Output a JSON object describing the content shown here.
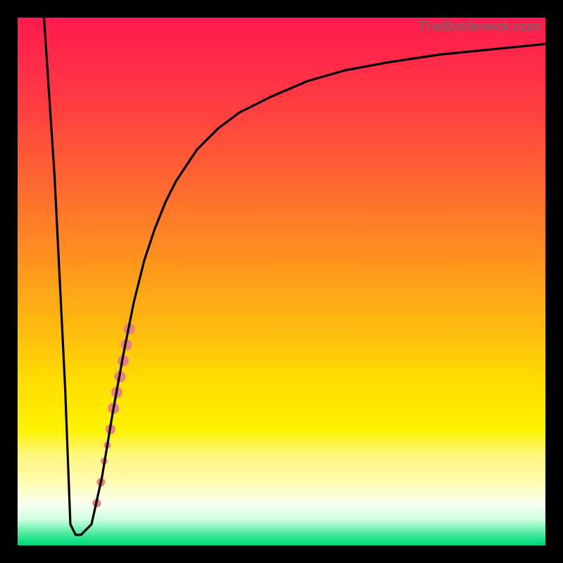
{
  "watermark": "TheBottleneck.com",
  "chart_data": {
    "type": "line",
    "title": "",
    "xlabel": "",
    "ylabel": "",
    "xlim": [
      0,
      100
    ],
    "ylim": [
      0,
      100
    ],
    "grid": false,
    "legend": false,
    "series": [
      {
        "name": "bottleneck-curve",
        "x": [
          5,
          7,
          9,
          10,
          11,
          12,
          14,
          16,
          18,
          20,
          22,
          24,
          26,
          28,
          30,
          34,
          38,
          42,
          48,
          55,
          62,
          70,
          80,
          90,
          100
        ],
        "y": [
          100,
          70,
          30,
          4,
          2,
          2,
          4,
          13,
          25,
          36,
          46,
          54,
          60,
          65,
          69,
          75,
          79,
          82,
          85,
          88,
          90,
          91.5,
          93,
          94,
          95
        ]
      }
    ],
    "markers": {
      "name": "highlighted-points",
      "color": "#e88080",
      "points": [
        {
          "x": 15.0,
          "y": 8,
          "r": 6
        },
        {
          "x": 15.8,
          "y": 12,
          "r": 6
        },
        {
          "x": 16.4,
          "y": 16,
          "r": 5
        },
        {
          "x": 17.0,
          "y": 19,
          "r": 5
        },
        {
          "x": 17.6,
          "y": 22,
          "r": 7
        },
        {
          "x": 18.2,
          "y": 26,
          "r": 8
        },
        {
          "x": 18.8,
          "y": 29,
          "r": 8
        },
        {
          "x": 19.4,
          "y": 32,
          "r": 8
        },
        {
          "x": 20.0,
          "y": 35,
          "r": 8
        },
        {
          "x": 20.6,
          "y": 38,
          "r": 8
        },
        {
          "x": 21.2,
          "y": 41,
          "r": 8
        }
      ]
    }
  }
}
